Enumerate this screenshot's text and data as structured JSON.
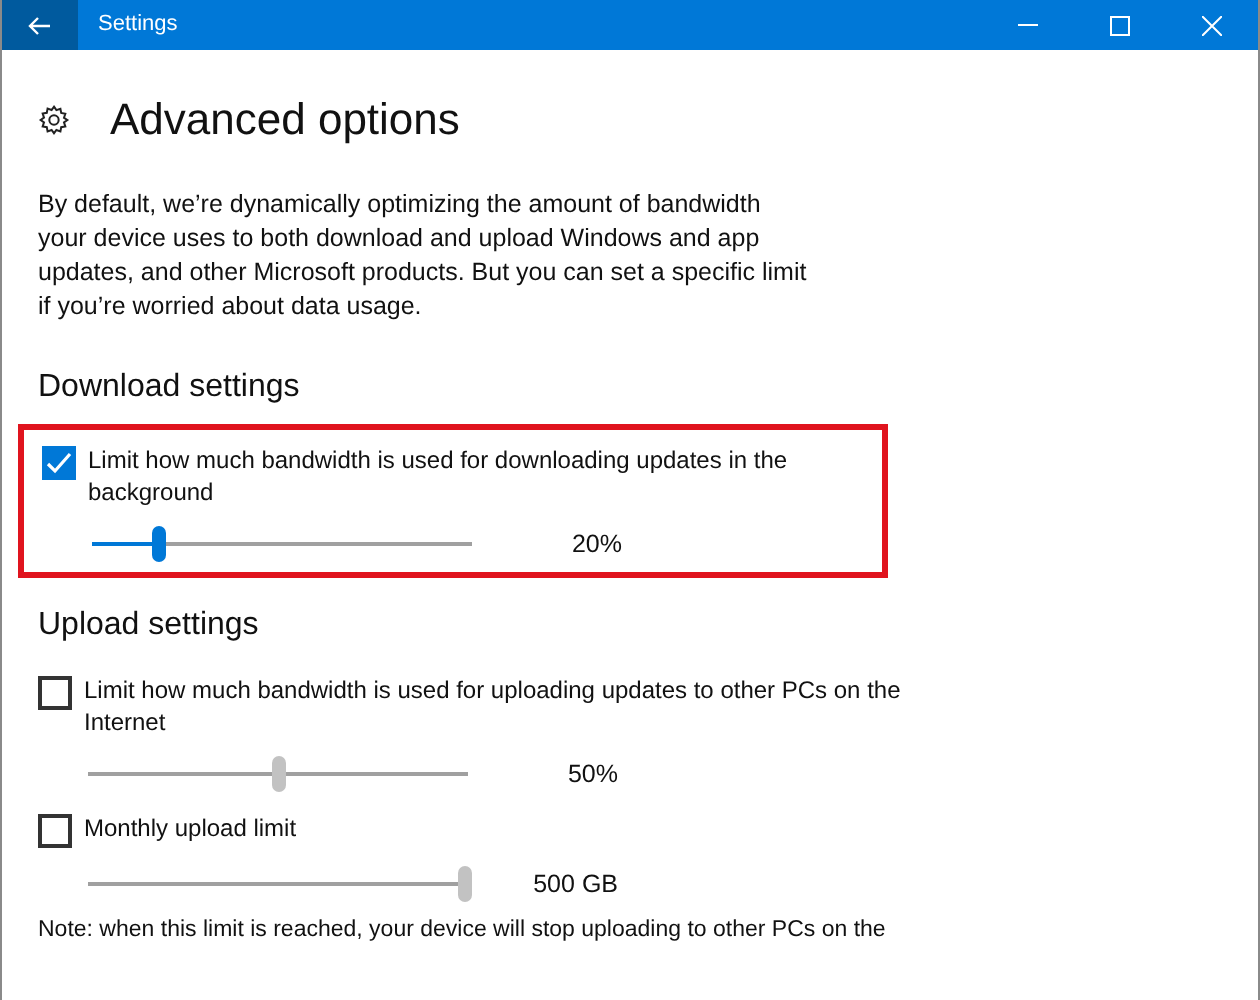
{
  "window": {
    "title": "Settings"
  },
  "page": {
    "title": "Advanced options",
    "description": "By default, we’re dynamically optimizing the amount of bandwidth your device uses to both download and upload Windows and app updates, and other Microsoft products. But you can set a specific limit if you’re worried about data usage."
  },
  "sections": [
    {
      "heading": "Download settings",
      "highlighted": true,
      "options": [
        {
          "label": "Limit how much bandwidth is used for downloading updates in the background",
          "checked": true,
          "slider": {
            "level": 0.17,
            "reading": "20%"
          }
        }
      ]
    },
    {
      "heading": "Upload settings",
      "highlighted": false,
      "options": [
        {
          "label": "Limit how much bandwidth is used for uploading updates to other PCs on the Internet",
          "checked": false,
          "slider": {
            "level": 0.5,
            "reading": "50%"
          }
        },
        {
          "label": "Monthly upload limit",
          "checked": false,
          "slider": {
            "level": 1,
            "reading": "500 GB"
          }
        }
      ]
    }
  ],
  "note": "Note: when this limit is reached, your device will stop uploading to other PCs on the"
}
